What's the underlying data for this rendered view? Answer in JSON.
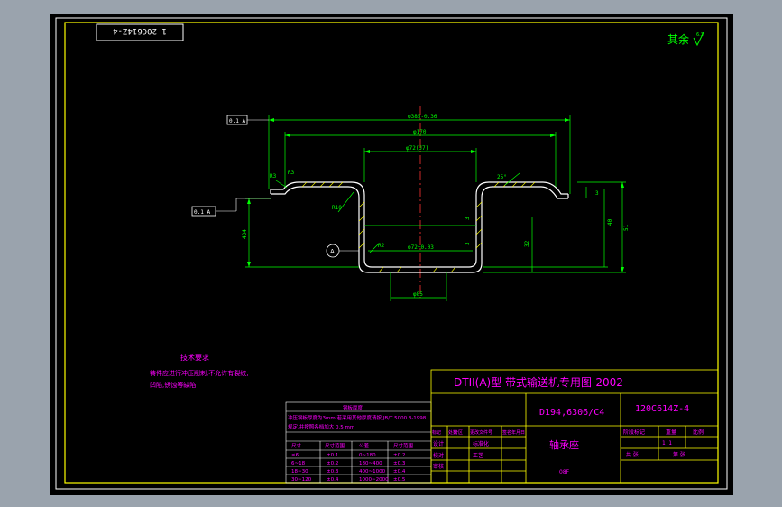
{
  "drawing": {
    "rotated_code": "1 20C614Z-4",
    "roughness_note": "其余",
    "roughness_value": "6.3",
    "tech_req_title": "技术要求",
    "tech_req_line1": "铸件应进行冲压削刺,不允许有裂纹,",
    "tech_req_line2": "凹陷,锈蚀等缺陷",
    "title_main": "DTII(A)型  带式输送机专用图-2002",
    "spec_code": "D194,6306/C4",
    "drawing_no": "120C614Z-4",
    "part_name": "轴承座",
    "material": "08F",
    "scale": "1:1",
    "stage_label": "阶段标记",
    "weight_label": "重量",
    "ratio_label": "比例",
    "sheet_label": "共  张",
    "page_label": "第  张",
    "std_label": "标准化",
    "design_label": "设计",
    "check_label": "校对",
    "approve_label": "审核",
    "process_label": "工艺",
    "zones": [
      "标记",
      "处数",
      "分区",
      "更改文件号",
      "签名",
      "年月日"
    ],
    "table_title": "钢板厚度",
    "table_note1": "冲压钢板厚度为3mm,若采用其他厚度请按 JB/T 5000.3-1998",
    "table_note2": "规定,并按照各档加大 0.5 mm",
    "table_header": [
      "尺寸",
      "尺寸范围",
      "公差",
      "尺寸范围",
      "公差"
    ],
    "table_rows": [
      [
        "≤6",
        "±0.1",
        "0~180",
        "±0.2"
      ],
      [
        "6~18",
        "±0.2",
        "180~400",
        "±0.3"
      ],
      [
        "18~30",
        "±0.3",
        "400~1000",
        "±0.4"
      ],
      [
        "30~120",
        "±0.4",
        "1000~2000",
        "±0.5"
      ]
    ]
  },
  "dims": {
    "top_width": "φ385-0.36",
    "flange_dia": "φ170",
    "inner_dia": "φ72(J7)",
    "bottom_hole": "φ72+0.03",
    "bottom_width": "φ85",
    "r3": "R3",
    "r10": "R10",
    "r2": "R2",
    "angle": "25°",
    "h_total": "51",
    "h_mid": "40",
    "h_lower": "32",
    "h_left": "434",
    "flange_t": "3",
    "label_a": "A",
    "gd1": "0.1 A",
    "gd2": "0.1 A"
  },
  "colors": {
    "bg": "#000000",
    "frame": "#ffff00",
    "part": "#ffffff",
    "dim": "#00ff00",
    "note": "#ff00ff",
    "hatch": "#ffff00",
    "center": "#ff3333"
  }
}
